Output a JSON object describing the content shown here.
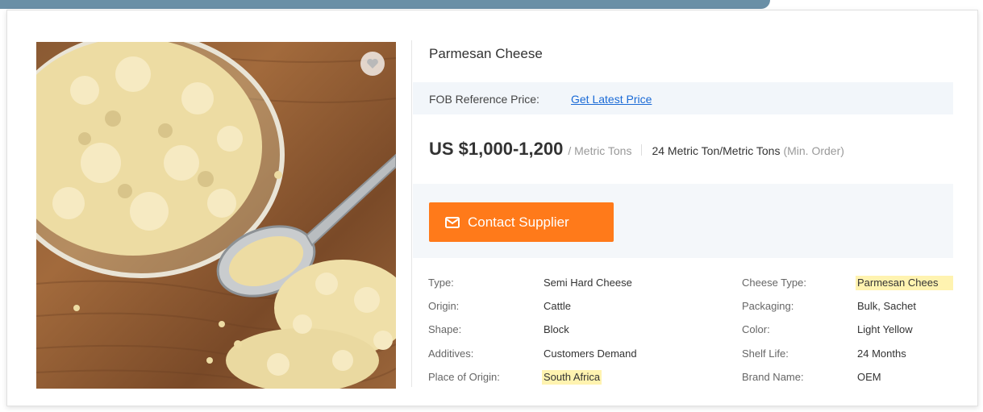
{
  "product": {
    "title": "Parmesan Cheese",
    "price_ref_label": "FOB Reference Price:",
    "price_ref_link": "Get Latest Price",
    "price": "US $1,000-1,200",
    "price_unit": "/ Metric Tons",
    "min_order": "24 Metric Ton/Metric Tons",
    "min_order_hint": "(Min. Order)",
    "contact_label": "Contact Supplier"
  },
  "attributes_left": [
    {
      "key": "Type:",
      "value": "Semi Hard Cheese",
      "highlight": false
    },
    {
      "key": "Origin:",
      "value": "Cattle",
      "highlight": false
    },
    {
      "key": "Shape:",
      "value": "Block",
      "highlight": false
    },
    {
      "key": "Additives:",
      "value": "Customers Demand",
      "highlight": false
    },
    {
      "key": "Place of Origin:",
      "value": "South Africa",
      "highlight": true
    }
  ],
  "attributes_right": [
    {
      "key": "Cheese Type:",
      "value": "Parmesan Chees",
      "highlight": true
    },
    {
      "key": "Packaging:",
      "value": "Bulk, Sachet",
      "highlight": false
    },
    {
      "key": "Color:",
      "value": "Light Yellow",
      "highlight": false
    },
    {
      "key": "Shelf Life:",
      "value": "24 Months",
      "highlight": false
    },
    {
      "key": "Brand Name:",
      "value": "OEM",
      "highlight": false
    }
  ],
  "icons": {
    "favorite": "heart-icon",
    "contact": "mail-icon"
  },
  "colors": {
    "accent": "#ff7a1a",
    "link": "#1a6ad6",
    "highlight": "#fff3b0"
  }
}
